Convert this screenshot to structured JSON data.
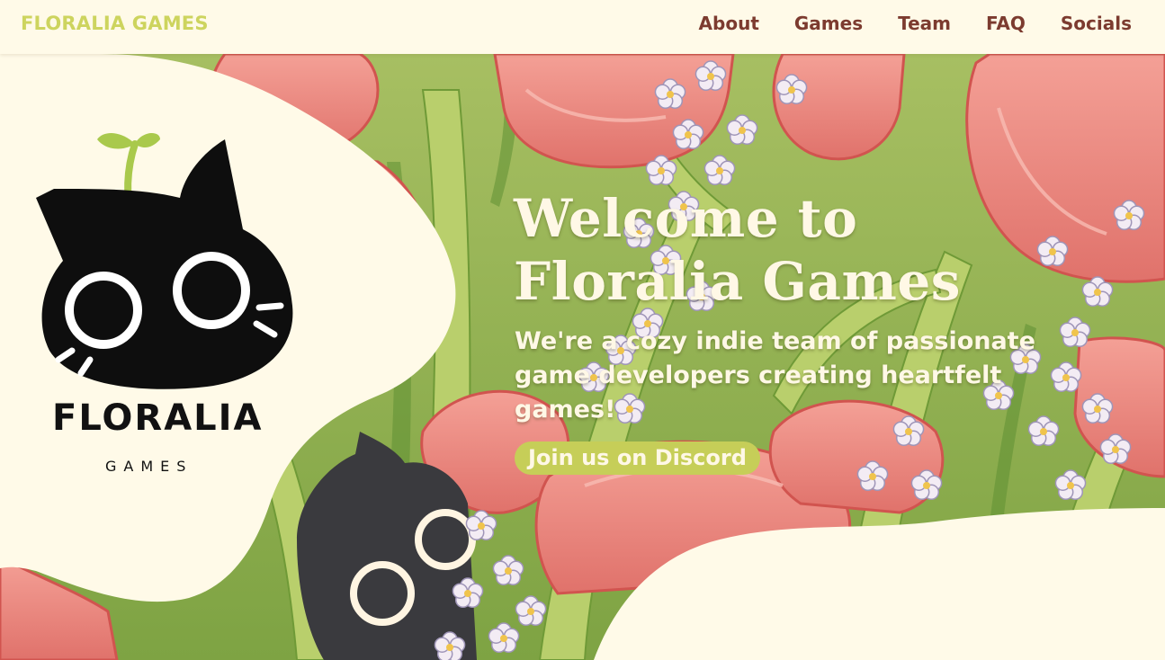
{
  "site": {
    "brand": "FLORALIA GAMES",
    "nav": [
      "About",
      "Games",
      "Team",
      "FAQ",
      "Socials"
    ]
  },
  "hero": {
    "headline_line1": "Welcome to",
    "headline_line2": "Floralia Games",
    "tagline": "We're a cozy indie team of passionate game developers creating heartfelt games!",
    "cta": "Join us on Discord"
  },
  "logo": {
    "wordmark": "FLORALIA",
    "sub": "GAMES"
  },
  "colors": {
    "background": "#fffae8",
    "brand": "#cdd45e",
    "nav_text": "#7c3b2f",
    "cta": "#c6ce58",
    "tulip": "#e98a84",
    "leaf": "#8fb24a"
  },
  "icons": [
    "cat-logo-icon",
    "sprout-icon",
    "forget-me-not-flower-icon",
    "tulip-icon"
  ]
}
